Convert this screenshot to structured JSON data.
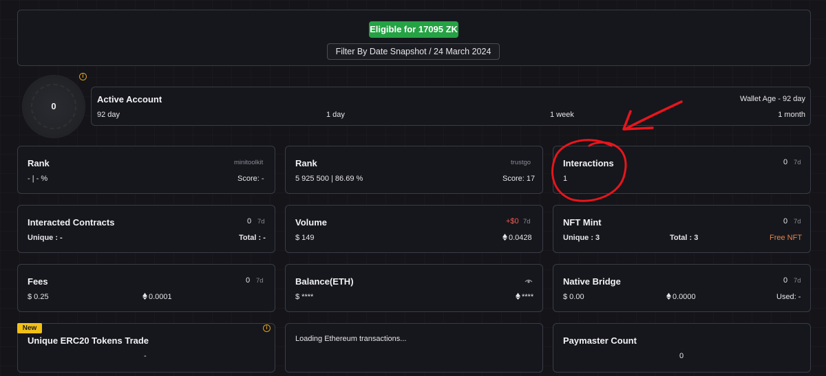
{
  "header": {
    "eligible_label": "Eligible for 17095 ZK",
    "filter_label": "Filter By Date Snapshot / 24 March 2024"
  },
  "score_ring": {
    "value": "0"
  },
  "active_account": {
    "title": "Active Account",
    "wallet_age": "Wallet Age - 92 day",
    "timeline": [
      "92 day",
      "1 day",
      "1 week",
      "1 month"
    ]
  },
  "cards": {
    "rank_minitoolkit": {
      "title": "Rank",
      "source": "minitoolkit",
      "value": "- | - %",
      "score": "Score: -"
    },
    "rank_trustgo": {
      "title": "Rank",
      "source": "trustgo",
      "value": "5 925 500 | 86.69 %",
      "score": "Score: 17"
    },
    "interactions": {
      "title": "Interactions",
      "count": "0",
      "period": "7d",
      "value": "1"
    },
    "interacted_contracts": {
      "title": "Interacted Contracts",
      "count": "0",
      "period": "7d",
      "unique": "Unique : -",
      "total": "Total : -"
    },
    "volume": {
      "title": "Volume",
      "delta": "+$0",
      "period": "7d",
      "usd": "$ 149",
      "eth": "0.0428"
    },
    "nft_mint": {
      "title": "NFT Mint",
      "count": "0",
      "period": "7d",
      "unique": "Unique : 3",
      "total": "Total : 3",
      "free": "Free NFT"
    },
    "fees": {
      "title": "Fees",
      "count": "0",
      "period": "7d",
      "usd": "$ 0.25",
      "eth": "0.0001"
    },
    "balance": {
      "title": "Balance(ETH)",
      "usd": "$ ****",
      "eth": "****"
    },
    "native_bridge": {
      "title": "Native Bridge",
      "count": "0",
      "period": "7d",
      "usd": "$ 0.00",
      "eth": "0.0000",
      "used": "Used: -"
    },
    "erc20": {
      "badge": "New",
      "title": "Unique ERC20 Tokens Trade",
      "value": "-"
    },
    "loading": {
      "text": "Loading Ethereum transactions..."
    },
    "paymaster": {
      "title": "Paymaster Count",
      "value": "0"
    }
  },
  "colors": {
    "eligible_green": "#25a244",
    "info_yellow": "#e0a21a",
    "new_badge": "#f2c015",
    "free_nft": "#e8834a",
    "delta_red": "#ef5b52",
    "annotation_red": "#e8151c"
  },
  "icons": [
    "info-icon",
    "ethereum-icon",
    "eye-icon"
  ]
}
